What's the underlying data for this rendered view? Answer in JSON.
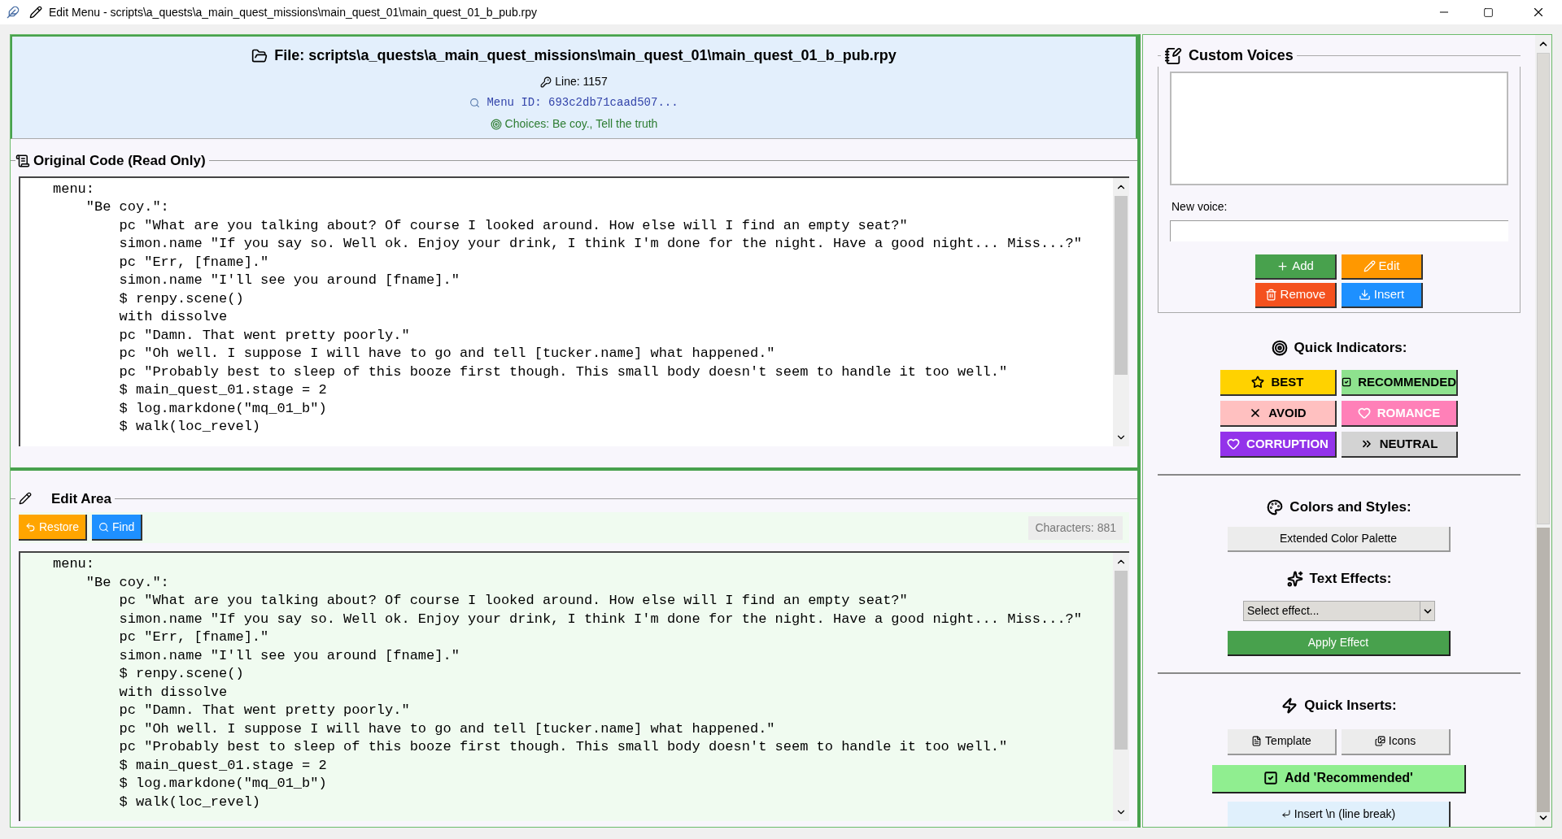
{
  "window": {
    "title": "Edit Menu - scripts\\a_quests\\a_main_quest_missions\\main_quest_01\\main_quest_01_b_pub.rpy"
  },
  "header": {
    "file": "File: scripts\\a_quests\\a_main_quest_missions\\main_quest_01\\main_quest_01_b_pub.rpy",
    "line": "Line: 1157",
    "menu_id": "Menu ID: 693c2db71caad507...",
    "choices": "Choices: Be coy., Tell the truth"
  },
  "original_code": {
    "title": "Original Code (Read Only)",
    "lines": [
      "menu:",
      "    \"Be coy.\":",
      "        pc \"What are you talking about? Of course I looked around. How else will I find an empty seat?\"",
      "        simon.name \"If you say so. Well ok. Enjoy your drink, I think I'm done for the night. Have a good night... Miss...?\"",
      "        pc \"Err, [fname].\"",
      "        simon.name \"I'll see you around [fname].\"",
      "        $ renpy.scene()",
      "        with dissolve",
      "        pc \"Damn. That went pretty poorly.\"",
      "        pc \"Oh well. I suppose I will have to go and tell [tucker.name] what happened.\"",
      "        pc \"Probably best to sleep of this booze first though. This small body doesn't seem to handle it too well.\"",
      "        $ main_quest_01.stage = 2",
      "        $ log.markdone(\"mq_01_b\")",
      "        $ walk(loc_revel)"
    ]
  },
  "edit_area": {
    "title": "Edit Area",
    "buttons": [
      {
        "label": "Restore",
        "kind": "restore"
      },
      {
        "label": "Find",
        "kind": "find"
      }
    ],
    "char_count": "Characters: 881",
    "lines": [
      "menu:",
      "    \"Be coy.\":",
      "        pc \"What are you talking about? Of course I looked around. How else will I find an empty seat?\"",
      "        simon.name \"If you say so. Well ok. Enjoy your drink, I think I'm done for the night. Have a good night... Miss...?\"",
      "        pc \"Err, [fname].\"",
      "        simon.name \"I'll see you around [fname].\"",
      "        $ renpy.scene()",
      "        with dissolve",
      "        pc \"Damn. That went pretty poorly.\"",
      "        pc \"Oh well. I suppose I will have to go and tell [tucker.name] what happened.\"",
      "        pc \"Probably best to sleep of this booze first though. This small body doesn't seem to handle it too well.\"",
      "        $ main_quest_01.stage = 2",
      "        $ log.markdone(\"mq_01_b\")",
      "        $ walk(loc_revel)"
    ]
  },
  "custom_voices": {
    "title": "Custom Voices",
    "new_voice_label": "New voice:",
    "buttons": [
      {
        "label": "Add",
        "kind": "add"
      },
      {
        "label": "Edit",
        "kind": "edit"
      },
      {
        "label": "Remove",
        "kind": "remove"
      },
      {
        "label": "Insert",
        "kind": "insert"
      }
    ]
  },
  "quick_indicators": {
    "title": "Quick Indicators:",
    "items": [
      {
        "label": "BEST",
        "kind": "best"
      },
      {
        "label": "RECOMMENDED",
        "kind": "recommended"
      },
      {
        "label": "AVOID",
        "kind": "avoid"
      },
      {
        "label": "ROMANCE",
        "kind": "romance"
      },
      {
        "label": "CORRUPTION",
        "kind": "corruption"
      },
      {
        "label": "NEUTRAL",
        "kind": "neutral"
      }
    ]
  },
  "colors_styles": {
    "title": "Colors and Styles:",
    "button": "Extended Color Palette"
  },
  "text_effects": {
    "title": "Text Effects:",
    "placeholder": "Select effect...",
    "button": "Apply Effect"
  },
  "quick_inserts": {
    "title": "Quick Inserts:",
    "buttons": [
      {
        "label": "Template",
        "kind": "template"
      },
      {
        "label": "Icons",
        "kind": "icons"
      }
    ],
    "recommended": "Add 'Recommended'",
    "line_break": "Insert \\n (line break)"
  }
}
